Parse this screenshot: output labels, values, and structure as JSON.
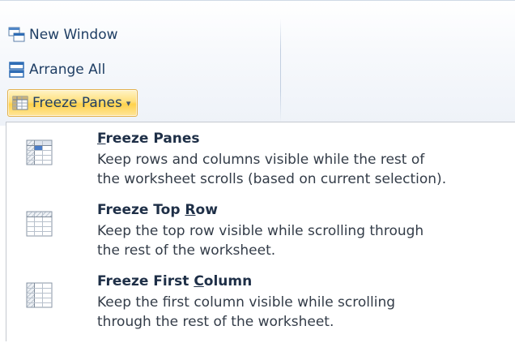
{
  "ribbon": {
    "new_window": {
      "label": "New Window",
      "icon": "new-window-icon"
    },
    "arrange_all": {
      "label": "Arrange All",
      "icon": "arrange-all-icon"
    },
    "freeze_panes": {
      "label": "Freeze Panes",
      "icon": "freeze-panes-icon",
      "caret": "▾"
    }
  },
  "menu": {
    "items": [
      {
        "title_pre": "",
        "title_accel": "F",
        "title_post": "reeze Panes",
        "desc_line1": "Keep rows and columns visible while the rest of",
        "desc_line2": "the worksheet scrolls (based on current selection).",
        "icon": "freeze-panes-grid-icon"
      },
      {
        "title_pre": "Freeze Top ",
        "title_accel": "R",
        "title_post": "ow",
        "desc_line1": "Keep the top row visible while scrolling through",
        "desc_line2": "the rest of the worksheet.",
        "icon": "freeze-top-row-grid-icon"
      },
      {
        "title_pre": "Freeze First ",
        "title_accel": "C",
        "title_post": "olumn",
        "desc_line1": "Keep the first column visible while scrolling",
        "desc_line2": "through the rest of the worksheet.",
        "icon": "freeze-first-column-grid-icon"
      }
    ]
  },
  "colors": {
    "highlight_border": "#e3b14d",
    "highlight_fill": "#ffdf7a",
    "icon_blue": "#2f6db5"
  }
}
